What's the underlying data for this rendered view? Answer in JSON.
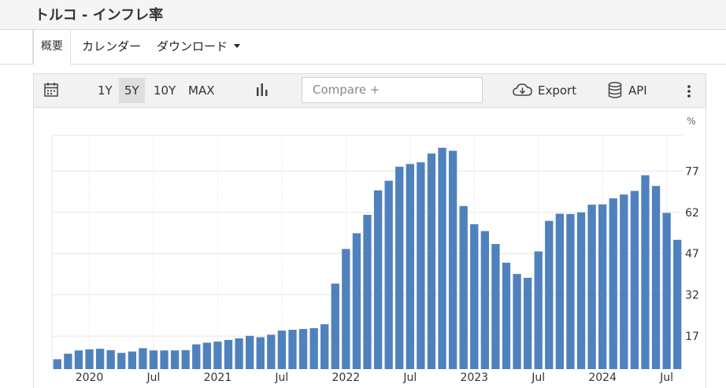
{
  "page": {
    "title": "トルコ - インフレ率"
  },
  "tabs": [
    {
      "label": "概要",
      "active": true
    },
    {
      "label": "カレンダー",
      "active": false
    },
    {
      "label": "ダウンロード",
      "active": false
    }
  ],
  "toolbar": {
    "ranges": [
      "1Y",
      "5Y",
      "10Y",
      "MAX"
    ],
    "active_range": "5Y",
    "compare_placeholder": "Compare +",
    "export_label": "Export",
    "api_label": "API"
  },
  "colors": {
    "bar": "#4f81bd",
    "grid": "#e6e6e6"
  },
  "chart_data": {
    "type": "bar",
    "unit_label": "%",
    "ylim": [
      5,
      90
    ],
    "yticks": [
      17,
      32,
      47,
      62,
      77
    ],
    "grid": true,
    "x_tick_labels": [
      {
        "label": "2020",
        "index": 3
      },
      {
        "label": "Jul",
        "index": 9
      },
      {
        "label": "2021",
        "index": 15
      },
      {
        "label": "Jul",
        "index": 21
      },
      {
        "label": "2022",
        "index": 27
      },
      {
        "label": "Jul",
        "index": 33
      },
      {
        "label": "2023",
        "index": 39
      },
      {
        "label": "Jul",
        "index": 45
      },
      {
        "label": "2024",
        "index": 51
      },
      {
        "label": "Jul",
        "index": 57
      }
    ],
    "categories": [
      "2019-10",
      "2019-11",
      "2019-12",
      "2020-01",
      "2020-02",
      "2020-03",
      "2020-04",
      "2020-05",
      "2020-06",
      "2020-07",
      "2020-08",
      "2020-09",
      "2020-10",
      "2020-11",
      "2020-12",
      "2021-01",
      "2021-02",
      "2021-03",
      "2021-04",
      "2021-05",
      "2021-06",
      "2021-07",
      "2021-08",
      "2021-09",
      "2021-10",
      "2021-11",
      "2021-12",
      "2022-01",
      "2022-02",
      "2022-03",
      "2022-04",
      "2022-05",
      "2022-06",
      "2022-07",
      "2022-08",
      "2022-09",
      "2022-10",
      "2022-11",
      "2022-12",
      "2023-01",
      "2023-02",
      "2023-03",
      "2023-04",
      "2023-05",
      "2023-06",
      "2023-07",
      "2023-08",
      "2023-09",
      "2023-10",
      "2023-11",
      "2023-12",
      "2024-01",
      "2024-02",
      "2024-03",
      "2024-04",
      "2024-05",
      "2024-06",
      "2024-07",
      "2024-08"
    ],
    "values": [
      8.6,
      10.6,
      11.8,
      12.2,
      12.4,
      11.9,
      10.9,
      11.4,
      12.6,
      11.8,
      11.8,
      11.8,
      11.9,
      14.0,
      14.6,
      15.0,
      15.6,
      16.2,
      17.1,
      16.6,
      17.5,
      19.0,
      19.3,
      19.6,
      19.9,
      21.3,
      36.1,
      48.7,
      54.4,
      61.1,
      70.0,
      73.5,
      78.6,
      79.6,
      80.2,
      83.4,
      85.5,
      84.4,
      64.3,
      57.7,
      55.2,
      50.5,
      43.7,
      39.6,
      38.2,
      47.8,
      58.9,
      61.5,
      61.4,
      62.0,
      64.8,
      64.9,
      67.1,
      68.5,
      69.8,
      75.5,
      71.6,
      61.8,
      52.0
    ]
  }
}
